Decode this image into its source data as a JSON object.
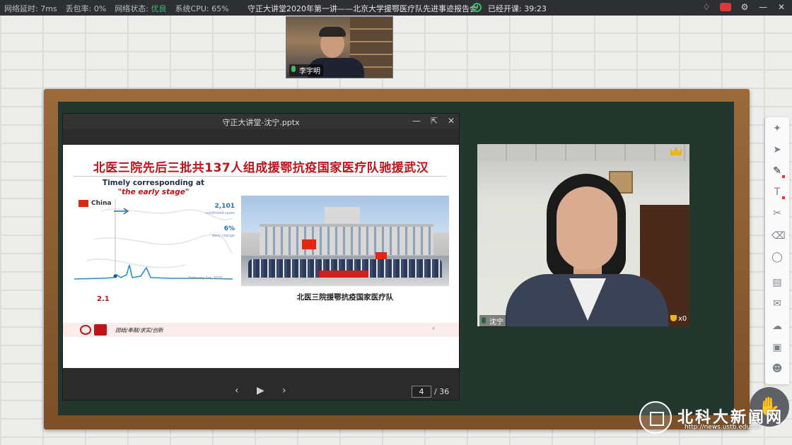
{
  "status_bar": {
    "latency": "网络延时: 7ms",
    "packet_loss": "丢包率: 0%",
    "network_state_label": "网络状态:",
    "network_state_value": "优良",
    "cpu": "系统CPU: 65%",
    "course_title": "守正大讲堂2020年第一讲——北京大学援鄂医疗队先进事迹报告会",
    "timer": "已经开课: 39:23",
    "icons": [
      "bell-icon",
      "record-icon",
      "settings-icon",
      "minimize-icon",
      "close-icon"
    ],
    "accent_green": "#3dbb6b"
  },
  "teacher_cam": {
    "name": "李宇明"
  },
  "ppt": {
    "window_title": "守正大讲堂-沈宁.pptx",
    "slide": {
      "title": "北医三院先后三批共137人组成援鄂抗疫国家医疗队驰援武汉",
      "chart_heading_1": "Timely corresponding at",
      "chart_heading_2": "\"the early stage\"",
      "country_label": "China",
      "kpi_cases_value": "2,101",
      "kpi_cases_label": "confirmed cases",
      "kpi_change_value": "6%",
      "kpi_change_label": "daily change",
      "chart_date": "February 1st, 2020",
      "chart_marker": "2.1",
      "photo_caption": "北医三院援鄂抗疫国家医疗队",
      "footer_motto": "团结/奉献/求实/创新",
      "footer_page": "4"
    },
    "current_page": "4",
    "total_pages": "/ 36",
    "title_color": "#c0141b"
  },
  "student_cam": {
    "name": "沈宁",
    "trophy_count": "x0"
  },
  "toolbar": {
    "tools": [
      "cursor-tool",
      "laser-pointer-tool",
      "pen-tool",
      "text-tool",
      "scissors-tool",
      "eraser-tool",
      "shape-tool",
      "notes-tool",
      "chat-tool",
      "cloud-tool",
      "toolbox-tool",
      "users-tool"
    ]
  },
  "watermark": {
    "name": "北科大新闻网",
    "url": "http://news.ustb.edu.cn"
  }
}
